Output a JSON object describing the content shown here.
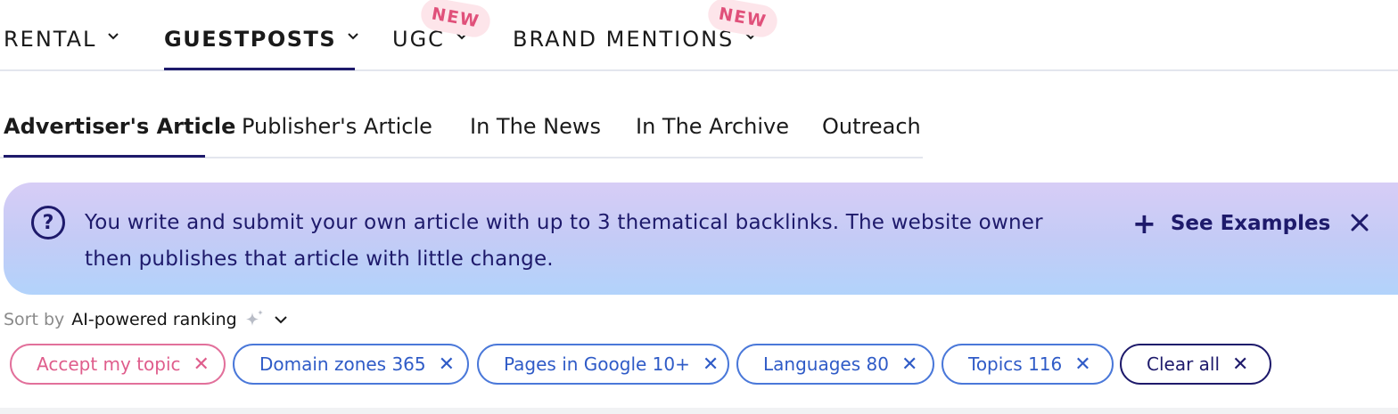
{
  "top_nav": {
    "items": [
      {
        "label": "RENTAL"
      },
      {
        "label": "GUESTPOSTS",
        "active": true
      },
      {
        "label": "UGC",
        "badge": "NEW"
      },
      {
        "label": "BRAND MENTIONS",
        "badge": "NEW"
      }
    ]
  },
  "sub_tabs": [
    {
      "label": "Advertiser's Article",
      "active": true
    },
    {
      "label": "Publisher's Article"
    },
    {
      "label": "In The News"
    },
    {
      "label": "In The Archive"
    },
    {
      "label": "Outreach"
    }
  ],
  "banner": {
    "icon": "question-circle-icon",
    "text": "You write and submit your own article with up to 3 thematical backlinks. The website owner then publishes that article with little change.",
    "action_plus": "+",
    "action_label": "See Examples",
    "close_icon": "close-icon"
  },
  "sort": {
    "label": "Sort by",
    "value": "AI-powered ranking"
  },
  "filters": [
    {
      "label": "Accept my topic",
      "style": "pink"
    },
    {
      "label": "Domain zones 365",
      "style": "blue"
    },
    {
      "label": "Pages in Google 10+",
      "style": "blue"
    },
    {
      "label": "Languages 80",
      "style": "blue"
    },
    {
      "label": "Topics 116",
      "style": "blue"
    },
    {
      "label": "Clear all",
      "style": "dark"
    }
  ],
  "filter_remove_glyph": "✕",
  "colors": {
    "brand_navy": "#1e1a6b",
    "chip_blue": "#2f5bc7",
    "chip_pink": "#df5d8c",
    "badge_bg": "#fde5ea",
    "badge_text": "#e0507a"
  }
}
